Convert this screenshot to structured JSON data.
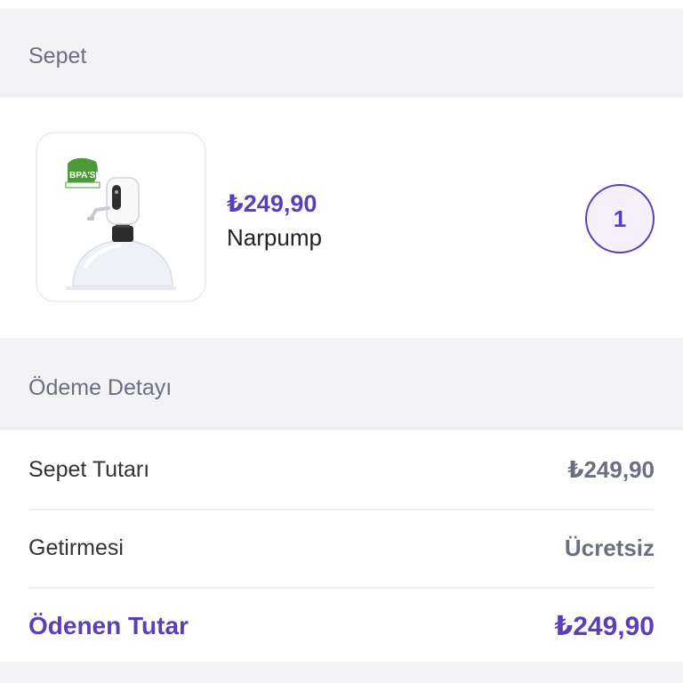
{
  "cart_section": {
    "title": "Sepet"
  },
  "cart_item": {
    "price": "₺249,90",
    "name": "Narpump",
    "quantity": "1",
    "badge_text": "BPA'SIZ"
  },
  "payment_section": {
    "title": "Ödeme Detayı",
    "rows": [
      {
        "label": "Sepet Tutarı",
        "value": "₺249,90"
      },
      {
        "label": "Getirmesi",
        "value": "Ücretsiz"
      },
      {
        "label": "Ödenen Tutar",
        "value": "₺249,90"
      }
    ]
  },
  "colors": {
    "accent": "#5b3fb4",
    "muted": "#6b6f80",
    "background": "#f3f3f5"
  }
}
